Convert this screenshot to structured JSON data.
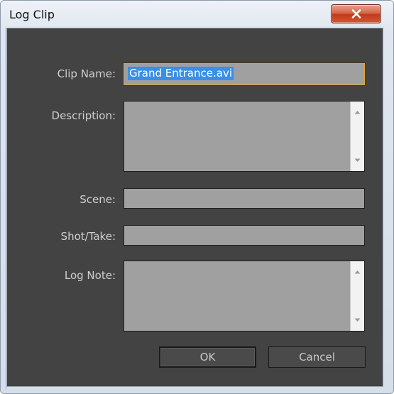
{
  "window": {
    "title": "Log Clip"
  },
  "form": {
    "clip_name_label": "Clip Name:",
    "clip_name_value": "Grand Entrance.avi",
    "description_label": "Description:",
    "description_value": "",
    "scene_label": "Scene:",
    "scene_value": "",
    "shot_take_label": "Shot/Take:",
    "shot_take_value": "",
    "log_note_label": "Log Note:",
    "log_note_value": ""
  },
  "buttons": {
    "ok_label": "OK",
    "cancel_label": "Cancel"
  },
  "icons": {
    "close": "close-icon",
    "scroll_up": "scroll-up-arrow-icon",
    "scroll_down": "scroll-down-arrow-icon"
  },
  "colors": {
    "dialog_background": "#434343",
    "field_background": "#a0a0a0",
    "focus_border": "#e3a634",
    "selection": "#3a8fe6",
    "close_button": "#c23a1a"
  }
}
